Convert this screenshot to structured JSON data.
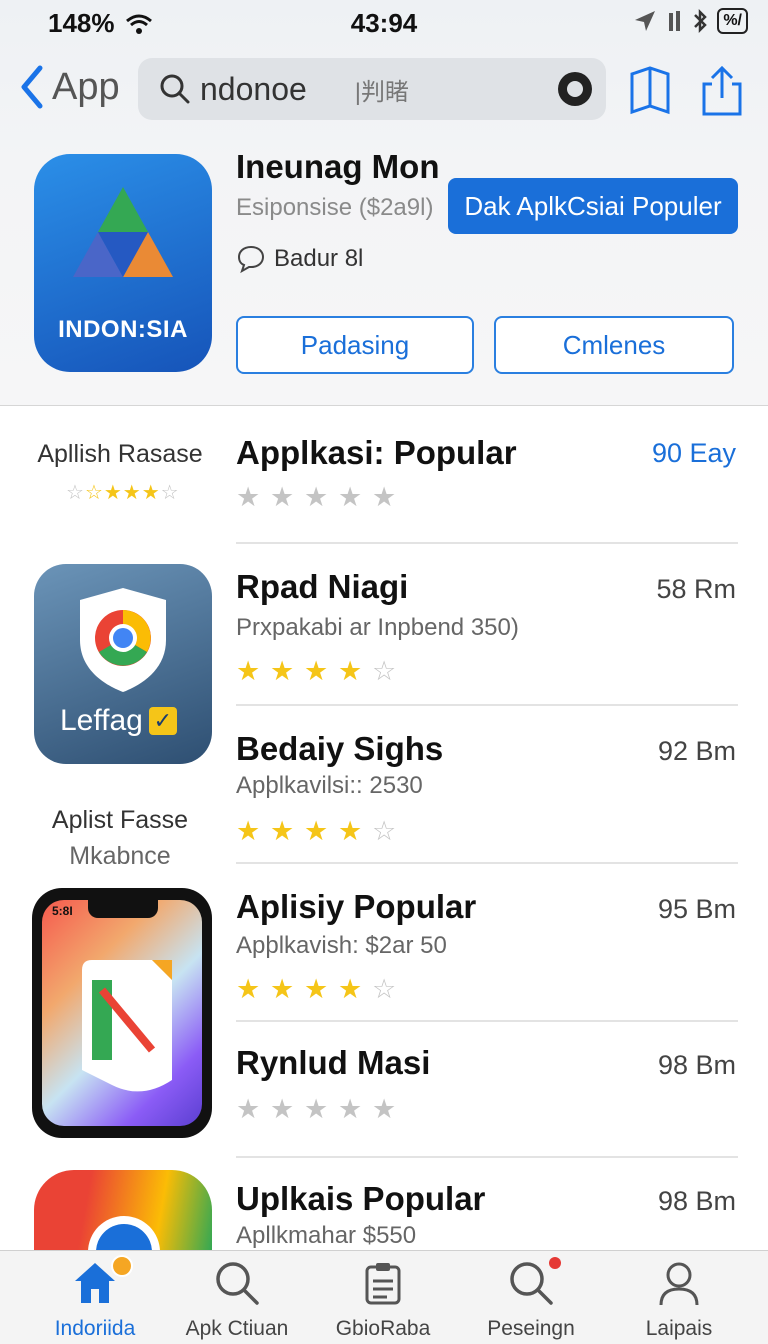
{
  "status_bar": {
    "battery_pct": "148%",
    "time": "43:94",
    "battery_label": "%/"
  },
  "nav": {
    "back_label": "App",
    "search_value": "ndonoe",
    "search_suffix": "|判睹"
  },
  "hero": {
    "icon_text": "INDON:SIA",
    "title": "Ineunag Mon",
    "subtitle": "Esiponsise ($2a9l)",
    "badge": "Badur 8l",
    "cta_label": "Dak AplkCsiai Populer",
    "button_left": "Padasing",
    "button_right": "Cmlenes"
  },
  "sidebar_labels": {
    "top": "Apllish Rasase",
    "middle_line1": "Aplist Fasse",
    "middle_line2": "Mkabnce",
    "tile_text": "Leffag",
    "phone_text": "5:8I"
  },
  "apps": [
    {
      "name": "Applkasi: Popular",
      "subtitle": "",
      "size": "90 Eay",
      "rating": 0
    },
    {
      "name": "Rpad Niagi",
      "subtitle": "Prxpakabi ar Inpbend 350)",
      "size": "58 Rm",
      "rating": 4.5
    },
    {
      "name": "Bedaiy Sighs",
      "subtitle": "Apþlkavilsi:: 2530",
      "size": "92 Bm",
      "rating": 4
    },
    {
      "name": "Aplisiy Popular",
      "subtitle": "Apþlkavish: $2ar 50",
      "size": "95 Bm",
      "rating": 4
    },
    {
      "name": "Rynlud Masi",
      "subtitle": "",
      "size": "98 Bm",
      "rating": 0
    },
    {
      "name": "Uplkais Popular",
      "subtitle": "Apllkmahar $550",
      "size": "98 Bm",
      "rating": 0
    }
  ],
  "tabs": [
    {
      "label": "Indoriida",
      "icon": "home-icon",
      "active": true
    },
    {
      "label": "Apk Ctiuan",
      "icon": "search-icon",
      "active": false
    },
    {
      "label": "GbioRaba",
      "icon": "clipboard-icon",
      "active": false
    },
    {
      "label": "Peseingn",
      "icon": "search-alert-icon",
      "active": false
    },
    {
      "label": "Laipais",
      "icon": "profile-icon",
      "active": false
    }
  ],
  "colors": {
    "accent": "#1a6fd9",
    "star": "#f5c518",
    "star_empty": "#c4c4c4"
  }
}
